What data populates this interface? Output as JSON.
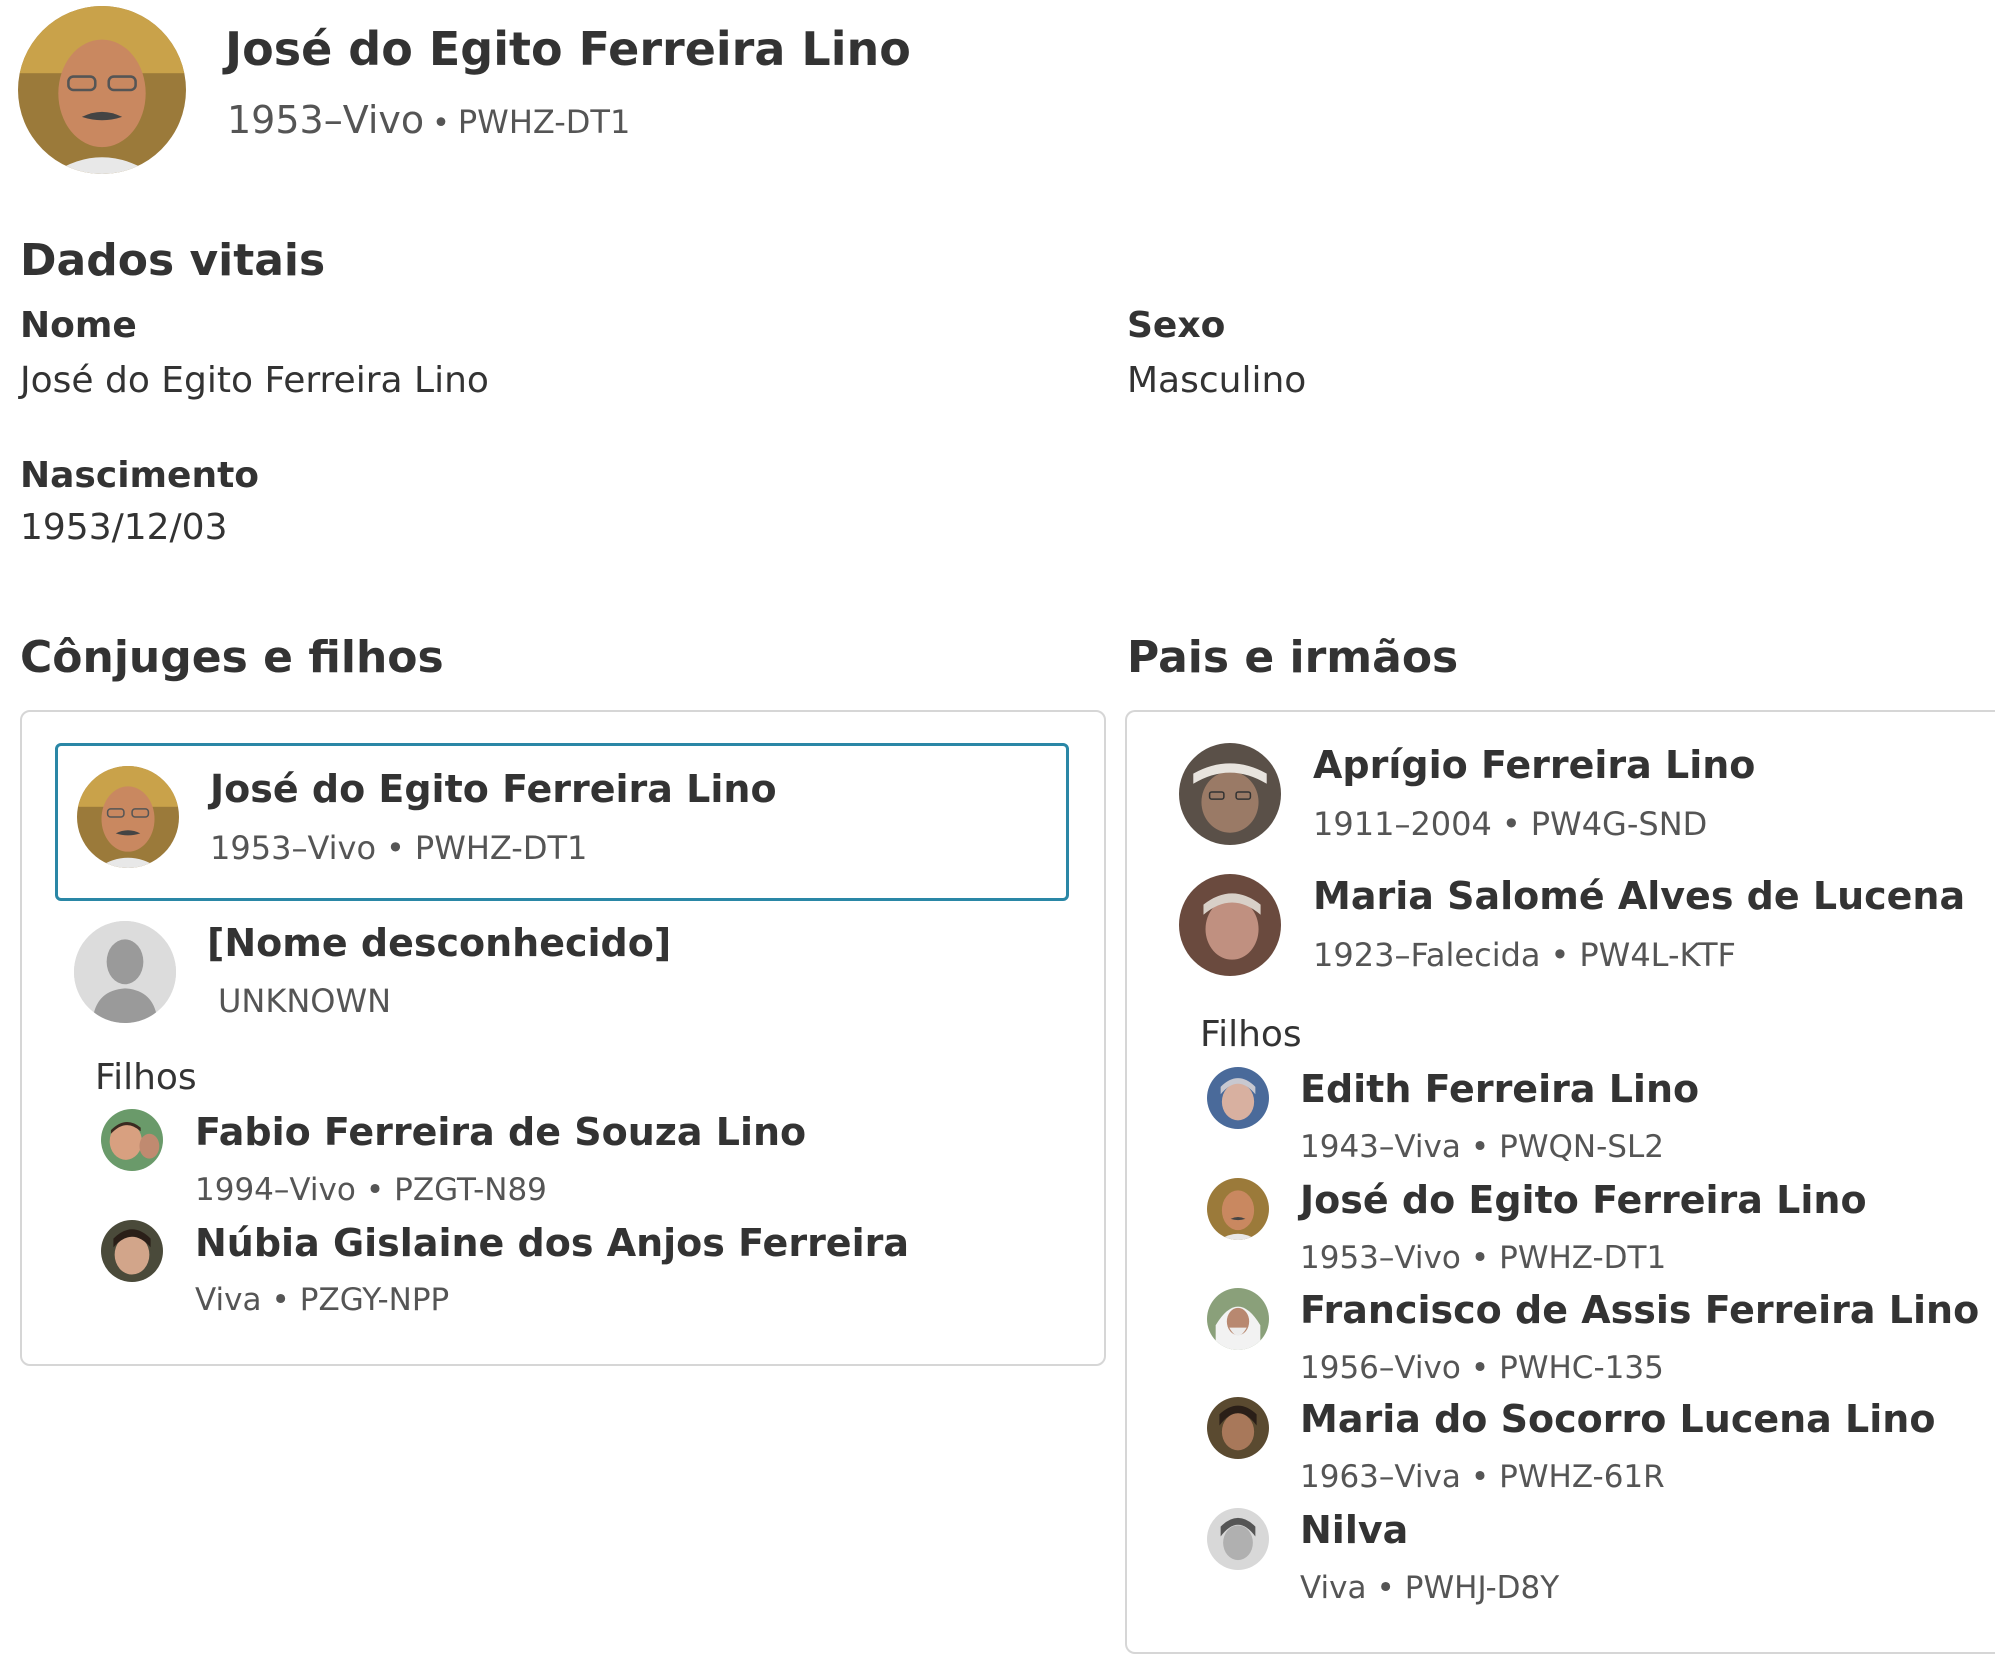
{
  "header": {
    "name": "José do Egito Ferreira Lino",
    "lifespan": "1953–Vivo",
    "pid": "PWHZ-DT1",
    "avatar_icon": "person-photo-icon"
  },
  "vitals": {
    "title": "Dados vitais",
    "name_label": "Nome",
    "name_value": "José do Egito Ferreira Lino",
    "sex_label": "Sexo",
    "sex_value": "Masculino",
    "birth_label": "Nascimento",
    "birth_value": "1953/12/03"
  },
  "spouses": {
    "title": "Cônjuges e filhos",
    "couple": [
      {
        "name": "José do Egito Ferreira Lino",
        "lifespan": "1953–Vivo",
        "pid": "PWHZ-DT1",
        "selected": true
      },
      {
        "name": "[Nome desconhecido]",
        "sub": "UNKNOWN",
        "selected": false
      }
    ],
    "children_label": "Filhos",
    "children": [
      {
        "name": "Fabio Ferreira de Souza Lino",
        "lifespan": "1994–Vivo",
        "pid": "PZGT-N89"
      },
      {
        "name": "Núbia Gislaine dos Anjos Ferreira",
        "lifespan": "Viva",
        "pid": "PZGY-NPP"
      }
    ]
  },
  "parents": {
    "title": "Pais e irmãos",
    "couple": [
      {
        "name": "Aprígio Ferreira Lino",
        "lifespan": "1911–2004",
        "pid": "PW4G-SND"
      },
      {
        "name": "Maria Salomé Alves de Lucena",
        "lifespan": "1923–Falecida",
        "pid": "PW4L-KTF"
      }
    ],
    "children_label": "Filhos",
    "children": [
      {
        "name": "Edith Ferreira Lino",
        "lifespan": "1943–Viva",
        "pid": "PWQN-SL2"
      },
      {
        "name": "José do Egito Ferreira Lino",
        "lifespan": "1953–Vivo",
        "pid": "PWHZ-DT1"
      },
      {
        "name": "Francisco de Assis Ferreira Lino",
        "lifespan": "1956–Vivo",
        "pid": "PWHC-135"
      },
      {
        "name": "Maria do Socorro Lucena Lino",
        "lifespan": "1963–Viva",
        "pid": "PWHZ-61R"
      },
      {
        "name": "Nilva",
        "lifespan": "Viva",
        "pid": "PWHJ-D8Y"
      }
    ]
  },
  "colors": {
    "selected_border": "#2a87a6",
    "card_border": "#d6d6d6",
    "text": "#333333",
    "muted_text": "#555555"
  }
}
